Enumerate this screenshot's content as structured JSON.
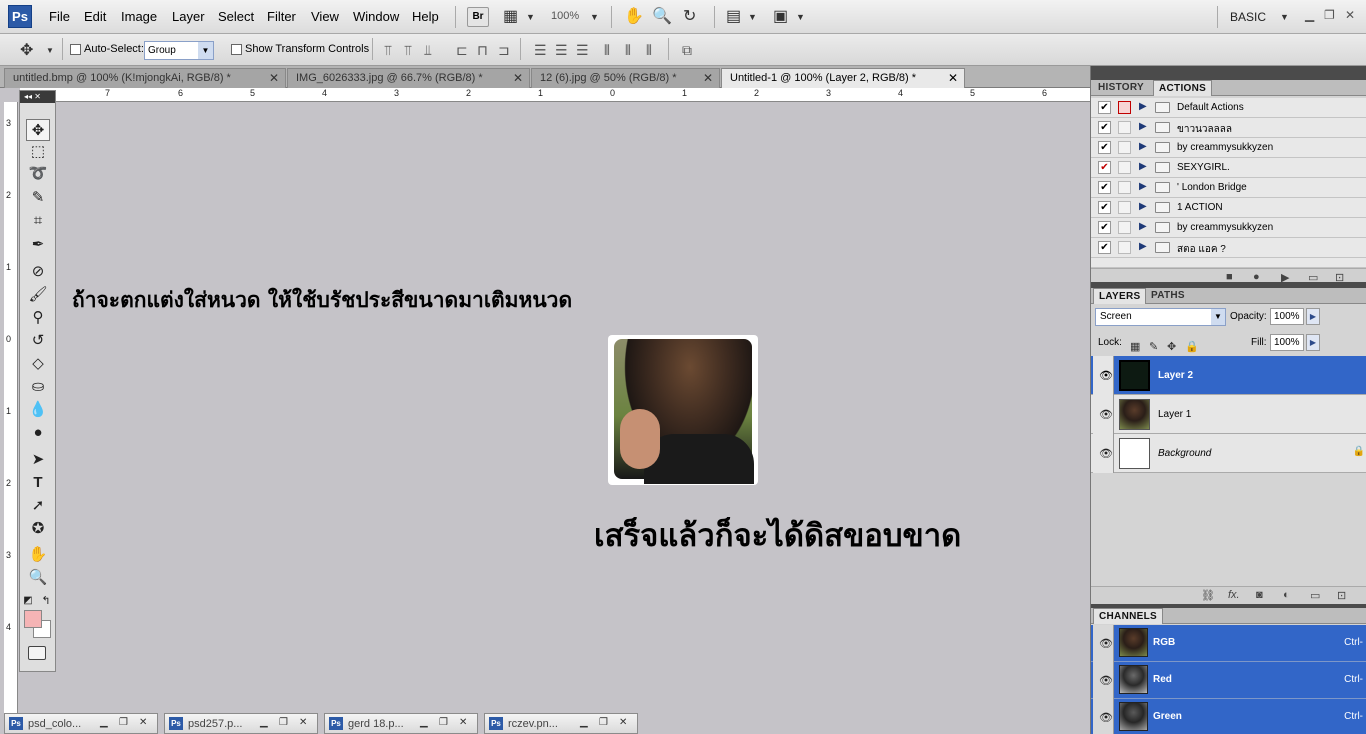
{
  "app": {
    "logo": "Ps",
    "workspace": "BASIC",
    "zoom_display": "100%"
  },
  "menu": [
    "File",
    "Edit",
    "Image",
    "Layer",
    "Select",
    "Filter",
    "View",
    "Window",
    "Help"
  ],
  "menubar_buttons": {
    "bridge": "Br"
  },
  "options": {
    "auto_select_label": "Auto-Select:",
    "auto_select_value": "Group",
    "show_transform_label": "Show Transform Controls"
  },
  "doc_tabs": [
    {
      "label": "untitled.bmp @ 100% (K!mjongkAi, RGB/8) *"
    },
    {
      "label": "IMG_6026333.jpg @ 66.7% (RGB/8) *"
    },
    {
      "label": "12 (6).jpg @ 50% (RGB/8) *"
    },
    {
      "label": "Untitled-1 @ 100% (Layer 2, RGB/8) *"
    }
  ],
  "rulers": {
    "h": [
      "7",
      "6",
      "5",
      "4",
      "3",
      "2",
      "1",
      "0",
      "1",
      "2",
      "3",
      "4",
      "5",
      "6"
    ],
    "v": [
      "3",
      "2",
      "1",
      "0",
      "1",
      "2",
      "3",
      "4"
    ]
  },
  "canvas": {
    "line1": "ถ้าจะตกแต่งใส่หนวด  ให้ใช้บรัชประสีขนาดมาเติมหนวด",
    "line2": "เสร็จแล้วก็จะได้ดิสขอบขาด"
  },
  "colors": {
    "foreground": "#f5b4b5",
    "background": "#ffffff",
    "selection": "#3266c8"
  },
  "history_panel": {
    "tabs": [
      "HISTORY",
      "ACTIONS"
    ],
    "actions": [
      {
        "name": "Default Actions",
        "check": "✔",
        "dialog_red": true
      },
      {
        "name": "ขาวนวลลลล",
        "check": "✔",
        "dialog_red": false
      },
      {
        "name": "by creammysukkyzen",
        "check": "✔",
        "dialog_red": false
      },
      {
        "name": "SEXYGIRL.",
        "check": "✔",
        "dialog_red": false
      },
      {
        "name": "' London Bridge",
        "check": "✔",
        "dialog_red": false
      },
      {
        "name": "1 ACTION",
        "check": "✔",
        "dialog_red": false
      },
      {
        "name": "by creammysukkyzen",
        "check": "✔",
        "dialog_red": false
      },
      {
        "name": "สตอ แอค ?",
        "check": "✔",
        "dialog_red": false
      }
    ]
  },
  "layers_panel": {
    "tabs": [
      "LAYERS",
      "PATHS"
    ],
    "blend_mode": "Screen",
    "opacity_label": "Opacity:",
    "opacity": "100%",
    "lock_label": "Lock:",
    "fill_label": "Fill:",
    "fill": "100%",
    "layers": [
      {
        "name": "Layer 2",
        "selected": true
      },
      {
        "name": "Layer 1",
        "selected": false
      },
      {
        "name": "Background",
        "selected": false
      }
    ]
  },
  "channels_panel": {
    "title": "CHANNELS",
    "channels": [
      {
        "name": "RGB",
        "shortcut": "Ctrl-"
      },
      {
        "name": "Red",
        "shortcut": "Ctrl-"
      },
      {
        "name": "Green",
        "shortcut": "Ctrl-"
      }
    ]
  },
  "minimized_docs": [
    {
      "label": "psd_colo..."
    },
    {
      "label": "psd257.p..."
    },
    {
      "label": "gerd 18.p..."
    },
    {
      "label": "rczev.pn..."
    }
  ]
}
